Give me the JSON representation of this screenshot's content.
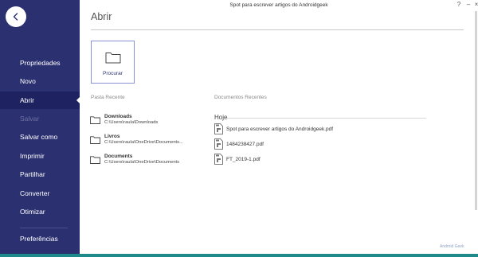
{
  "window": {
    "title": "Spot para escrever artigos do Androidgeek",
    "help_label": "?",
    "minimize_label": "–",
    "close_label": "×"
  },
  "sidebar": {
    "items": [
      {
        "label": "Propriedades",
        "state": "normal"
      },
      {
        "label": "Novo",
        "state": "normal"
      },
      {
        "label": "Abrir",
        "state": "active"
      },
      {
        "label": "Salvar",
        "state": "disabled"
      },
      {
        "label": "Salvar como",
        "state": "normal"
      },
      {
        "label": "Imprimir",
        "state": "normal"
      },
      {
        "label": "Partilhar",
        "state": "normal"
      },
      {
        "label": "Converter",
        "state": "normal"
      },
      {
        "label": "Otimizar",
        "state": "normal"
      },
      {
        "label": "Preferências",
        "state": "normal"
      }
    ]
  },
  "main": {
    "title": "Abrir",
    "browse_label": "Procurar",
    "recent_folders_label": "Pasta Recente",
    "recent_docs_label": "Documentos Recentes",
    "folders": [
      {
        "name": "Downloads",
        "path": "C:\\Users\\raula\\Downloads"
      },
      {
        "name": "Livros",
        "path": "C:\\Users\\raula\\OneDrive\\Documents..."
      },
      {
        "name": "Documents",
        "path": "C:\\Users\\raula\\OneDrive\\Documents"
      }
    ],
    "doc_group": "Hoje",
    "documents": [
      {
        "name": "Spot para escrever artigos do Androidgeek.pdf"
      },
      {
        "name": "1484238427.pdf"
      },
      {
        "name": "FT_2019-1.pdf"
      }
    ]
  },
  "watermark": "Android Geek",
  "colors": {
    "sidebar_bg": "#2b3070",
    "sidebar_active": "#1f2260",
    "accent": "#8a90d6",
    "bottom_strip": "#1f8a8a"
  }
}
